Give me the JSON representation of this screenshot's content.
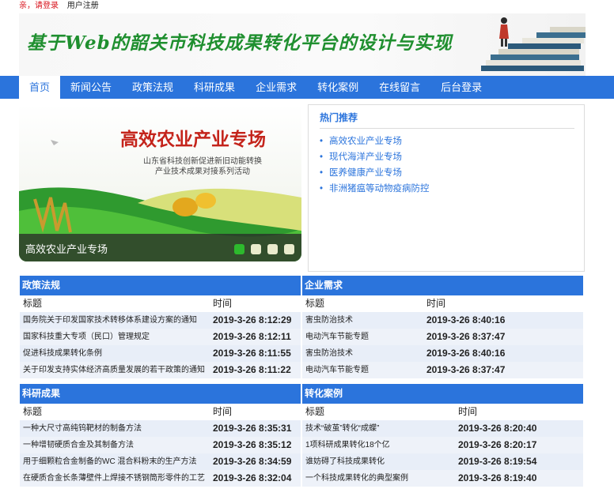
{
  "topbar": {
    "login": "亲，请登录",
    "register": "用户注册"
  },
  "banner": {
    "title": "基于Web的韶关市科技成果转化平台的设计与实现"
  },
  "nav": [
    "首页",
    "新闻公告",
    "政策法规",
    "科研成果",
    "企业需求",
    "转化案例",
    "在线留言",
    "后台登录"
  ],
  "slider": {
    "headline": "高效农业产业专场",
    "sub1": "山东省科技创新促进新旧动能转换",
    "sub2": "产业技术成果对接系列活动",
    "caption": "高效农业产业专场"
  },
  "hot": {
    "title": "热门推荐",
    "items": [
      "高效农业产业专场",
      "现代海洋产业专场",
      "医养健康产业专场",
      "非洲猪瘟等动物疫病防控"
    ]
  },
  "sections": {
    "policy": {
      "title": "政策法规",
      "col_title": "标题",
      "col_time": "时间",
      "rows": [
        {
          "title": "国务院关于印发国家技术转移体系建设方案的通知",
          "time": "2019-3-26 8:12:29"
        },
        {
          "title": "国家科技重大专项（民口）管理规定",
          "time": "2019-3-26 8:12:11"
        },
        {
          "title": "促进科技成果转化条例",
          "time": "2019-3-26 8:11:55"
        },
        {
          "title": "关于印发支持实体经济高质量发展的若干政策的通知",
          "time": "2019-3-26 8:11:22"
        }
      ]
    },
    "demand": {
      "title": "企业需求",
      "col_title": "标题",
      "col_time": "时间",
      "rows": [
        {
          "title": "害虫防治技术",
          "time": "2019-3-26 8:40:16"
        },
        {
          "title": "电动汽车节能专题",
          "time": "2019-3-26 8:37:47"
        },
        {
          "title": "害虫防治技术",
          "time": "2019-3-26 8:40:16"
        },
        {
          "title": "电动汽车节能专题",
          "time": "2019-3-26 8:37:47"
        }
      ]
    },
    "research": {
      "title": "科研成果",
      "col_title": "标题",
      "col_time": "时间",
      "rows": [
        {
          "title": "一种大尺寸高纯钨靶材的制备方法",
          "time": "2019-3-26 8:35:31"
        },
        {
          "title": "一种增韧硬质合金及其制备方法",
          "time": "2019-3-26 8:35:12"
        },
        {
          "title": "用于细颗粒合金制备的WC 混合料粉末的生产方法",
          "time": "2019-3-26 8:34:59"
        },
        {
          "title": "在硬质合金长条薄壁件上焊接不锈钢筒形零件的工艺",
          "time": "2019-3-26 8:32:04"
        }
      ]
    },
    "cases": {
      "title": "转化案例",
      "col_title": "标题",
      "col_time": "时间",
      "rows": [
        {
          "title": "技术“破茧”转化“成蝶”",
          "time": "2019-3-26 8:20:40"
        },
        {
          "title": "1项科研成果转化18个亿",
          "time": "2019-3-26 8:20:17"
        },
        {
          "title": "谁妨碍了科技成果转化",
          "time": "2019-3-26 8:19:54"
        },
        {
          "title": "一个科技成果转化的典型案例",
          "time": "2019-3-26 8:19:40"
        }
      ]
    }
  }
}
